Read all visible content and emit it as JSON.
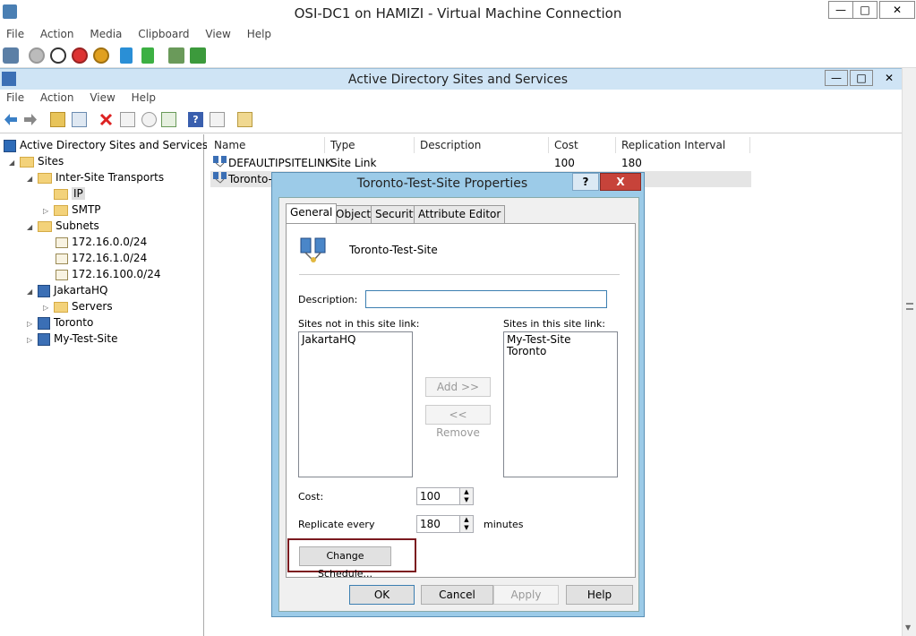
{
  "vm": {
    "title": "OSI-DC1 on HAMIZI - Virtual Machine Connection",
    "menu": [
      "File",
      "Action",
      "Media",
      "Clipboard",
      "View",
      "Help"
    ],
    "window_buttons": {
      "minimize": "—",
      "maximize": "□",
      "close": "✕"
    }
  },
  "mmc": {
    "title": "Active Directory Sites and Services",
    "menu": [
      "File",
      "Action",
      "View",
      "Help"
    ]
  },
  "tree": {
    "root": "Active Directory Sites and Services [LO",
    "sites": "Sites",
    "inter_site_transports": "Inter-Site Transports",
    "ip": "IP",
    "smtp": "SMTP",
    "subnets": "Subnets",
    "subnet_items": [
      "172.16.0.0/24",
      "172.16.1.0/24",
      "172.16.100.0/24"
    ],
    "jakarta": "JakartaHQ",
    "servers": "Servers",
    "toronto": "Toronto",
    "mytestsite": "My-Test-Site"
  },
  "list": {
    "headers": [
      "Name",
      "Type",
      "Description",
      "Cost",
      "Replication Interval"
    ],
    "rows": [
      {
        "name": "DEFAULTIPSITELINK",
        "type": "Site Link",
        "description": "",
        "cost": "100",
        "interval": "180"
      },
      {
        "name": "Toronto-",
        "type": "",
        "description": "",
        "cost": "",
        "interval": ""
      }
    ]
  },
  "dialog": {
    "title": "Toronto-Test-Site Properties",
    "help_label": "?",
    "close_label": "X",
    "tabs": [
      "General",
      "Object",
      "Security",
      "Attribute Editor"
    ],
    "object_name": "Toronto-Test-Site",
    "description_label": "Description:",
    "description_value": "",
    "not_in_label": "Sites not in this site link:",
    "in_label": "Sites in this site link:",
    "not_in_items": [
      "JakartaHQ"
    ],
    "in_items": [
      "My-Test-Site",
      "Toronto"
    ],
    "add_button": "Add >>",
    "remove_button": "<< Remove",
    "cost_label": "Cost:",
    "cost_value": "100",
    "replicate_label": "Replicate every",
    "replicate_value": "180",
    "minutes_label": "minutes",
    "change_schedule": "Change Schedule...",
    "ok": "OK",
    "cancel": "Cancel",
    "apply": "Apply",
    "help": "Help"
  },
  "colors": {
    "dialog_frame": "#9ccbe8",
    "close_red": "#c7433a",
    "highlight_box": "#7b1a1f"
  }
}
